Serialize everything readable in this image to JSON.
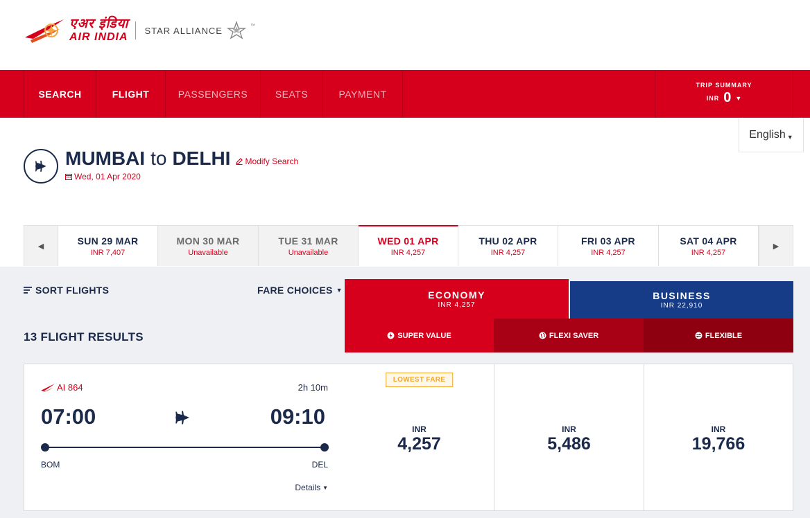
{
  "brand": {
    "hindi_name": "एअर इंडिया",
    "english_name": "AIR INDIA",
    "alliance": "STAR ALLIANCE",
    "alliance_tm": "™"
  },
  "nav": {
    "items": [
      {
        "label": "SEARCH",
        "active": true
      },
      {
        "label": "FLIGHT",
        "active": true
      },
      {
        "label": "PASSENGERS",
        "active": false
      },
      {
        "label": "SEATS",
        "active": false
      },
      {
        "label": "PAYMENT",
        "active": false
      }
    ],
    "trip_summary": {
      "label": "TRIP SUMMARY",
      "currency": "INR",
      "amount": "0"
    }
  },
  "language": {
    "selected": "English"
  },
  "route": {
    "origin": "MUMBAI",
    "connector": "to",
    "destination": "DELHI",
    "modify_label": "Modify Search",
    "date": "Wed, 01 Apr 2020"
  },
  "date_strip": {
    "items": [
      {
        "day": "SUN 29 MAR",
        "price": "INR 7,407",
        "state": "available"
      },
      {
        "day": "MON 30 MAR",
        "price": "Unavailable",
        "state": "unavailable"
      },
      {
        "day": "TUE 31 MAR",
        "price": "Unavailable",
        "state": "unavailable"
      },
      {
        "day": "WED 01 APR",
        "price": "INR 4,257",
        "state": "selected"
      },
      {
        "day": "THU 02 APR",
        "price": "INR 4,257",
        "state": "available"
      },
      {
        "day": "FRI 03 APR",
        "price": "INR 4,257",
        "state": "available"
      },
      {
        "day": "SAT 04 APR",
        "price": "INR 4,257",
        "state": "available"
      }
    ]
  },
  "results": {
    "sort_label": "SORT FLIGHTS",
    "fare_choices_label": "FARE CHOICES",
    "count_label": "13 FLIGHT RESULTS"
  },
  "cabins": {
    "economy": {
      "name": "ECONOMY",
      "price": "INR 4,257"
    },
    "business": {
      "name": "BUSINESS",
      "price": "INR 22,910"
    }
  },
  "fare_types": [
    {
      "label": "SUPER VALUE",
      "color": "#d6001c"
    },
    {
      "label": "FLEXI SAVER",
      "color": "#a80015"
    },
    {
      "label": "FLEXIBLE",
      "color": "#8e0010"
    }
  ],
  "flight": {
    "number": "AI 864",
    "duration": "2h 10m",
    "departure_time": "07:00",
    "arrival_time": "09:10",
    "from": "BOM",
    "to": "DEL",
    "details_label": "Details",
    "fares": [
      {
        "badge": "LOWEST FARE",
        "currency": "INR",
        "amount": "4,257"
      },
      {
        "badge": "",
        "currency": "INR",
        "amount": "5,486"
      },
      {
        "badge": "",
        "currency": "INR",
        "amount": "19,766"
      }
    ]
  },
  "colors": {
    "brand_red": "#d6001c",
    "navy": "#1b2a4a",
    "business_blue": "#163b87",
    "lowest_badge": "#f0a830"
  }
}
